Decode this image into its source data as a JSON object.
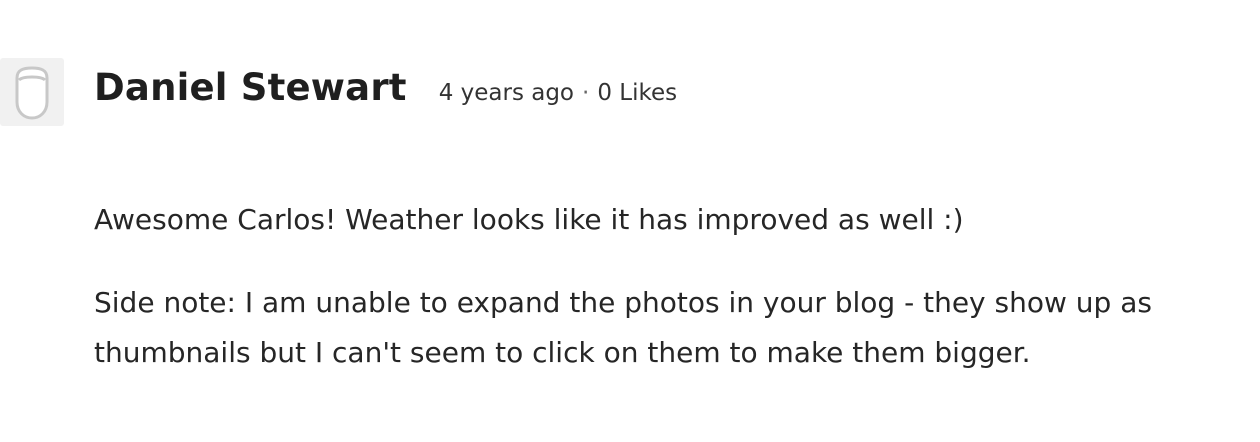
{
  "comment": {
    "author": "Daniel Stewart",
    "time_ago": "4 years ago",
    "separator": "·",
    "likes": "0 Likes",
    "avatar_icon": "user-placeholder-icon",
    "paragraphs": [
      "Awesome Carlos! Weather looks like it has improved as well :)",
      "Side note: I am unable to expand the photos in your blog - they show up as thumbnails but I can't seem to click on them to make them bigger."
    ]
  },
  "colors": {
    "avatar_bg": "#f1f1f1",
    "avatar_stroke": "#c8c8c8",
    "text": "#262626"
  }
}
